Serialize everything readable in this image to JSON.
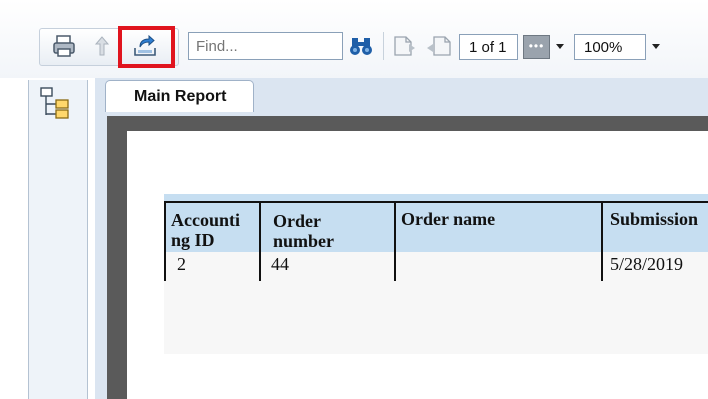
{
  "toolbar": {
    "find_placeholder": "Find...",
    "page_indicator": "1 of 1",
    "zoom_value": "100%",
    "icons": [
      "print-icon",
      "up-arrow-icon",
      "export-icon",
      "binoculars-icon",
      "prev-page-icon",
      "next-page-icon"
    ]
  },
  "tabs": [
    {
      "label": "Main Report"
    }
  ],
  "report": {
    "columns": [
      "Accounti\nng ID",
      "Order\nnumber",
      "Order name",
      "Submission"
    ],
    "rows": [
      [
        "2",
        "44",
        "",
        "5/28/2019"
      ]
    ]
  },
  "colors": {
    "highlight": "#e0141e",
    "header_band": "#c6def1",
    "tab_strip": "#dbe5f1"
  }
}
